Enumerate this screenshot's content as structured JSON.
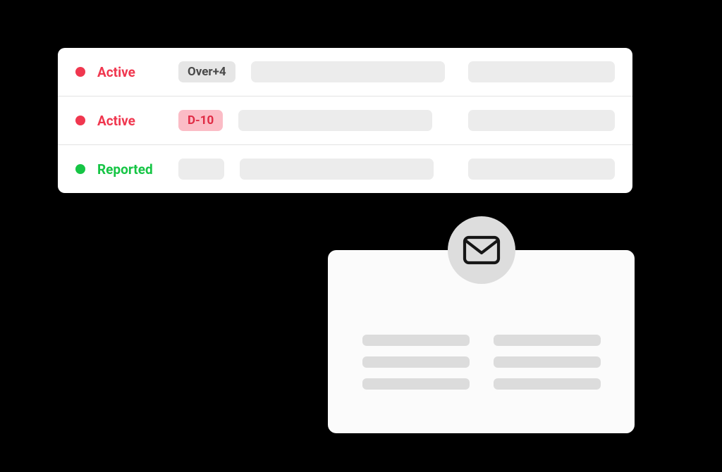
{
  "status_panel": {
    "rows": [
      {
        "status_color": "red",
        "status_label": "Active",
        "pill_type": "gray",
        "pill_text": "Over+4"
      },
      {
        "status_color": "red",
        "status_label": "Active",
        "pill_type": "pink",
        "pill_text": "D-10"
      },
      {
        "status_color": "green",
        "status_label": "Reported",
        "pill_type": "placeholder",
        "pill_text": ""
      }
    ]
  },
  "mail_card": {
    "icon": "mail-icon"
  }
}
